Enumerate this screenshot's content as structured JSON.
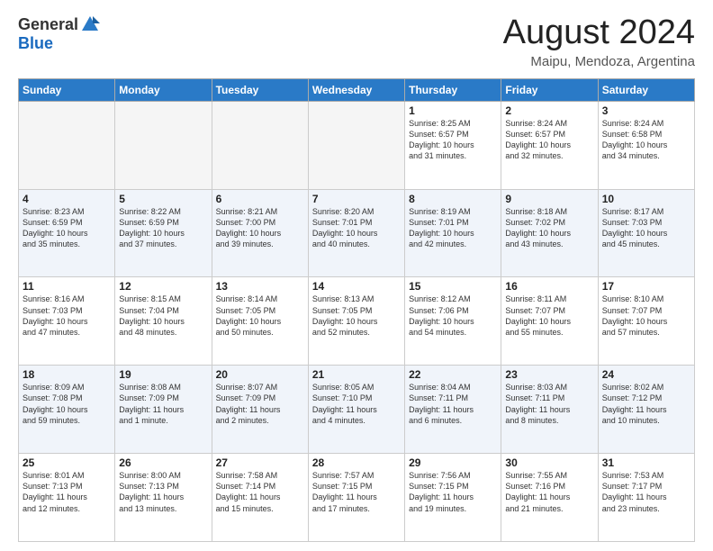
{
  "header": {
    "logo_general": "General",
    "logo_blue": "Blue",
    "month_title": "August 2024",
    "location": "Maipu, Mendoza, Argentina"
  },
  "weekdays": [
    "Sunday",
    "Monday",
    "Tuesday",
    "Wednesday",
    "Thursday",
    "Friday",
    "Saturday"
  ],
  "weeks": [
    [
      {
        "day": "",
        "info": ""
      },
      {
        "day": "",
        "info": ""
      },
      {
        "day": "",
        "info": ""
      },
      {
        "day": "",
        "info": ""
      },
      {
        "day": "1",
        "info": "Sunrise: 8:25 AM\nSunset: 6:57 PM\nDaylight: 10 hours\nand 31 minutes."
      },
      {
        "day": "2",
        "info": "Sunrise: 8:24 AM\nSunset: 6:57 PM\nDaylight: 10 hours\nand 32 minutes."
      },
      {
        "day": "3",
        "info": "Sunrise: 8:24 AM\nSunset: 6:58 PM\nDaylight: 10 hours\nand 34 minutes."
      }
    ],
    [
      {
        "day": "4",
        "info": "Sunrise: 8:23 AM\nSunset: 6:59 PM\nDaylight: 10 hours\nand 35 minutes."
      },
      {
        "day": "5",
        "info": "Sunrise: 8:22 AM\nSunset: 6:59 PM\nDaylight: 10 hours\nand 37 minutes."
      },
      {
        "day": "6",
        "info": "Sunrise: 8:21 AM\nSunset: 7:00 PM\nDaylight: 10 hours\nand 39 minutes."
      },
      {
        "day": "7",
        "info": "Sunrise: 8:20 AM\nSunset: 7:01 PM\nDaylight: 10 hours\nand 40 minutes."
      },
      {
        "day": "8",
        "info": "Sunrise: 8:19 AM\nSunset: 7:01 PM\nDaylight: 10 hours\nand 42 minutes."
      },
      {
        "day": "9",
        "info": "Sunrise: 8:18 AM\nSunset: 7:02 PM\nDaylight: 10 hours\nand 43 minutes."
      },
      {
        "day": "10",
        "info": "Sunrise: 8:17 AM\nSunset: 7:03 PM\nDaylight: 10 hours\nand 45 minutes."
      }
    ],
    [
      {
        "day": "11",
        "info": "Sunrise: 8:16 AM\nSunset: 7:03 PM\nDaylight: 10 hours\nand 47 minutes."
      },
      {
        "day": "12",
        "info": "Sunrise: 8:15 AM\nSunset: 7:04 PM\nDaylight: 10 hours\nand 48 minutes."
      },
      {
        "day": "13",
        "info": "Sunrise: 8:14 AM\nSunset: 7:05 PM\nDaylight: 10 hours\nand 50 minutes."
      },
      {
        "day": "14",
        "info": "Sunrise: 8:13 AM\nSunset: 7:05 PM\nDaylight: 10 hours\nand 52 minutes."
      },
      {
        "day": "15",
        "info": "Sunrise: 8:12 AM\nSunset: 7:06 PM\nDaylight: 10 hours\nand 54 minutes."
      },
      {
        "day": "16",
        "info": "Sunrise: 8:11 AM\nSunset: 7:07 PM\nDaylight: 10 hours\nand 55 minutes."
      },
      {
        "day": "17",
        "info": "Sunrise: 8:10 AM\nSunset: 7:07 PM\nDaylight: 10 hours\nand 57 minutes."
      }
    ],
    [
      {
        "day": "18",
        "info": "Sunrise: 8:09 AM\nSunset: 7:08 PM\nDaylight: 10 hours\nand 59 minutes."
      },
      {
        "day": "19",
        "info": "Sunrise: 8:08 AM\nSunset: 7:09 PM\nDaylight: 11 hours\nand 1 minute."
      },
      {
        "day": "20",
        "info": "Sunrise: 8:07 AM\nSunset: 7:09 PM\nDaylight: 11 hours\nand 2 minutes."
      },
      {
        "day": "21",
        "info": "Sunrise: 8:05 AM\nSunset: 7:10 PM\nDaylight: 11 hours\nand 4 minutes."
      },
      {
        "day": "22",
        "info": "Sunrise: 8:04 AM\nSunset: 7:11 PM\nDaylight: 11 hours\nand 6 minutes."
      },
      {
        "day": "23",
        "info": "Sunrise: 8:03 AM\nSunset: 7:11 PM\nDaylight: 11 hours\nand 8 minutes."
      },
      {
        "day": "24",
        "info": "Sunrise: 8:02 AM\nSunset: 7:12 PM\nDaylight: 11 hours\nand 10 minutes."
      }
    ],
    [
      {
        "day": "25",
        "info": "Sunrise: 8:01 AM\nSunset: 7:13 PM\nDaylight: 11 hours\nand 12 minutes."
      },
      {
        "day": "26",
        "info": "Sunrise: 8:00 AM\nSunset: 7:13 PM\nDaylight: 11 hours\nand 13 minutes."
      },
      {
        "day": "27",
        "info": "Sunrise: 7:58 AM\nSunset: 7:14 PM\nDaylight: 11 hours\nand 15 minutes."
      },
      {
        "day": "28",
        "info": "Sunrise: 7:57 AM\nSunset: 7:15 PM\nDaylight: 11 hours\nand 17 minutes."
      },
      {
        "day": "29",
        "info": "Sunrise: 7:56 AM\nSunset: 7:15 PM\nDaylight: 11 hours\nand 19 minutes."
      },
      {
        "day": "30",
        "info": "Sunrise: 7:55 AM\nSunset: 7:16 PM\nDaylight: 11 hours\nand 21 minutes."
      },
      {
        "day": "31",
        "info": "Sunrise: 7:53 AM\nSunset: 7:17 PM\nDaylight: 11 hours\nand 23 minutes."
      }
    ]
  ]
}
